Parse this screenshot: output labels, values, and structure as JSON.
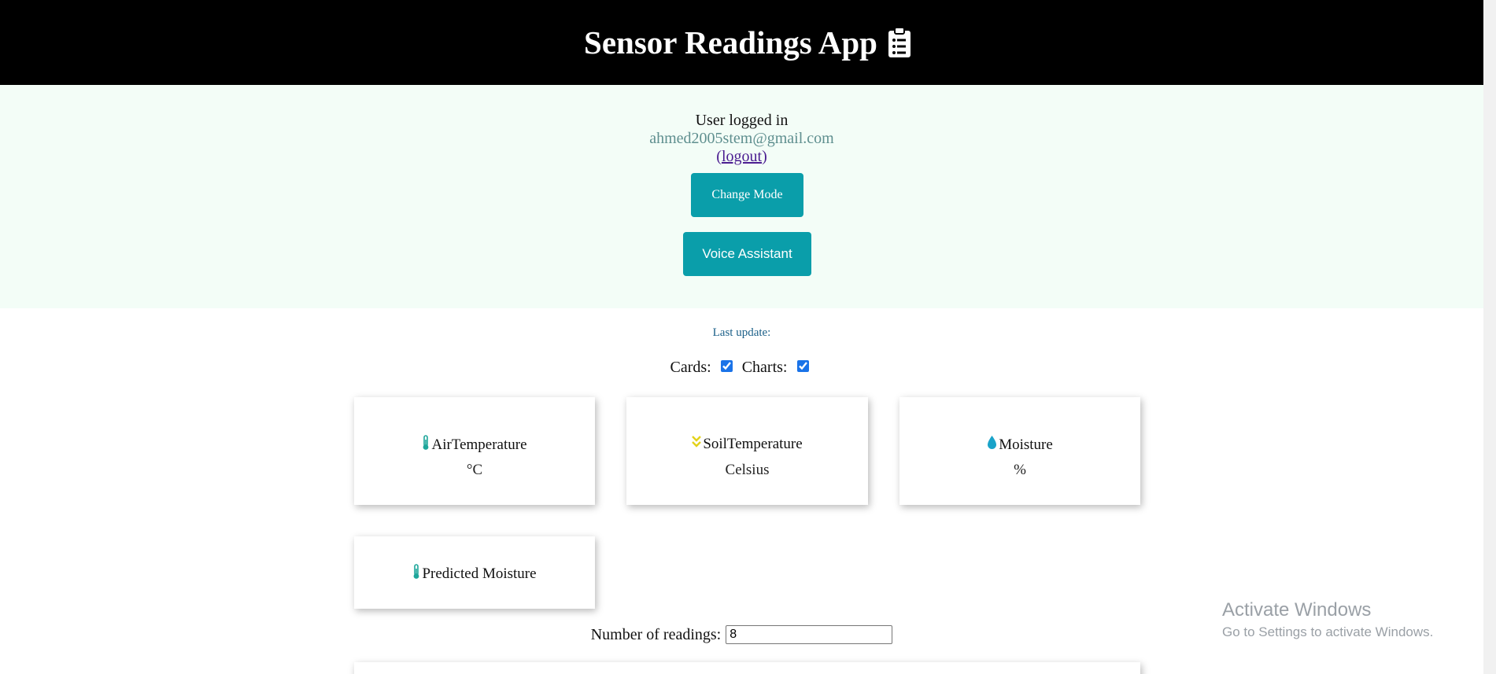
{
  "header": {
    "title": "Sensor Readings App",
    "icon": "clipboard-list-icon"
  },
  "auth": {
    "status_text": "User logged in",
    "email": "ahmed2005stem@gmail.com",
    "logout_label": "logout"
  },
  "buttons": {
    "change_mode": "Change Mode",
    "voice_assistant": "Voice Assistant"
  },
  "last_update": {
    "label": "Last update:"
  },
  "toggles": {
    "cards_label": "Cards:",
    "cards_checked": true,
    "charts_label": "Charts:",
    "charts_checked": true
  },
  "cards": [
    {
      "title": "AirTemperature",
      "unit": "°C",
      "icon": "thermometer-icon",
      "icon_color": "#1ea69b"
    },
    {
      "title": "SoilTemperature",
      "unit": "Celsius",
      "icon": "double-chevron-down-icon",
      "icon_color": "#e3d21a"
    },
    {
      "title": "Moisture",
      "unit": "%",
      "icon": "droplet-icon",
      "icon_color": "#1aa3c9"
    },
    {
      "title": "Predicted Moisture",
      "icon": "thermometer-icon",
      "icon_color": "#1ea69b"
    }
  ],
  "readings": {
    "label": "Number of readings:",
    "value": "8"
  },
  "watermark": {
    "line1": "Activate Windows",
    "line2": "Go to Settings to activate Windows."
  },
  "colors": {
    "header_bg": "#000000",
    "accent": "#0a9eaa",
    "auth_bg": "#f3fdf7"
  }
}
